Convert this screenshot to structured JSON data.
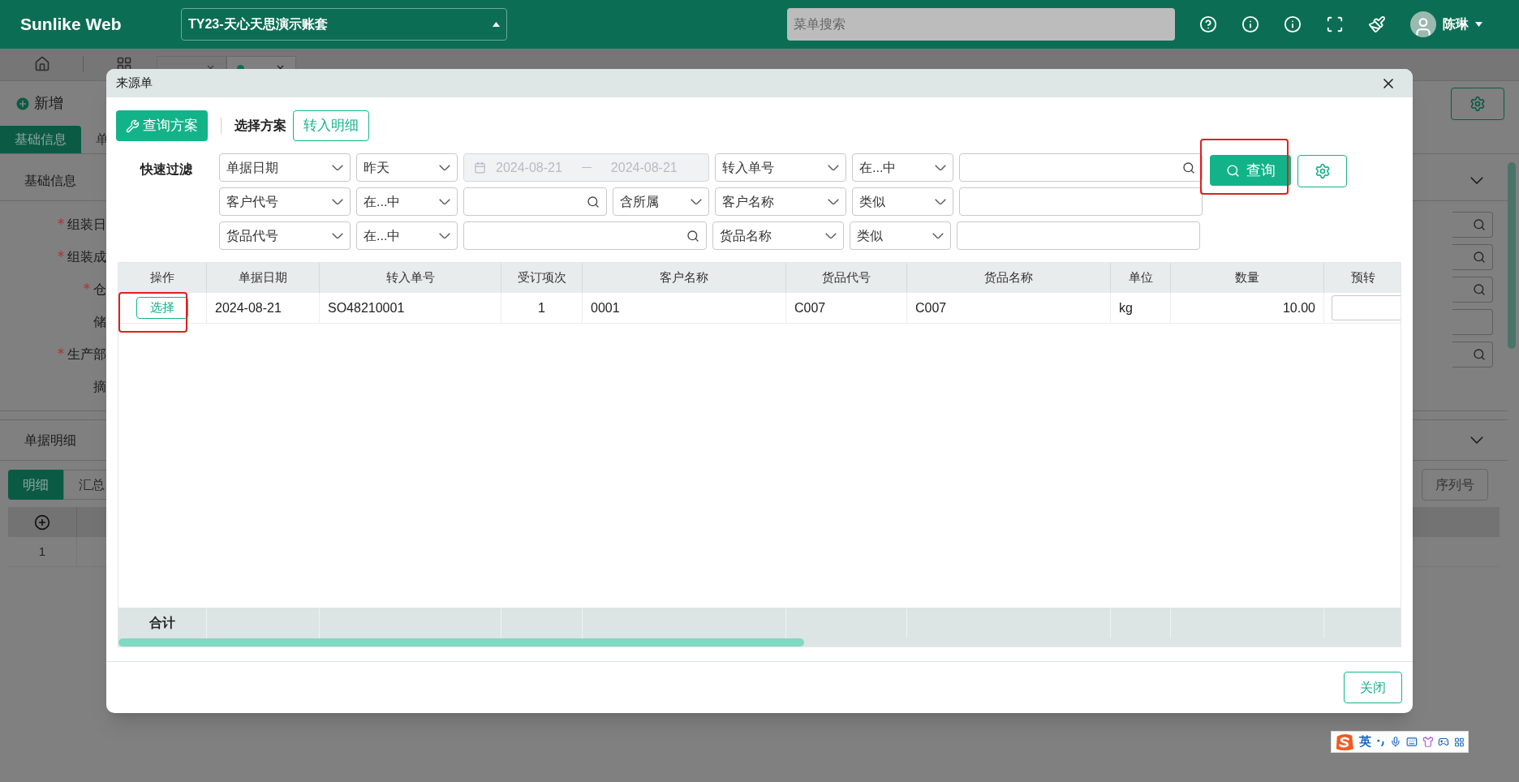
{
  "header": {
    "logo": "Sunlike Web",
    "account": "TY23-天心天思演示账套",
    "search_placeholder": "菜单搜索",
    "user": "陈琳"
  },
  "page_tabs": [
    {
      "selected": false
    },
    {
      "selected": true
    }
  ],
  "toolbar": {
    "new_button": "新增"
  },
  "form_tabs": [
    {
      "label": "基础信息",
      "selected": true
    },
    {
      "label": "单",
      "selected": false
    }
  ],
  "basic_section": {
    "title": "基础信息",
    "fields": [
      {
        "label": "组装日",
        "required": true,
        "kind": "search"
      },
      {
        "label": "组装成",
        "required": true,
        "kind": "search"
      },
      {
        "label": "仓",
        "required": true,
        "kind": "search"
      },
      {
        "label": "储",
        "required": false,
        "kind": "plain"
      },
      {
        "label": "生产部",
        "required": true,
        "kind": "search"
      },
      {
        "label": "摘",
        "required": false,
        "kind": "none"
      }
    ]
  },
  "detail_section": {
    "title": "单据明细",
    "tabs": [
      {
        "label": "明细",
        "selected": true
      },
      {
        "label": "汇总",
        "selected": false
      }
    ],
    "serial_button": "序列号",
    "rows": [
      "1"
    ]
  },
  "dialog": {
    "title": "来源单",
    "scheme_button": "查询方案",
    "scheme_label": "选择方案",
    "transfer_button": "转入明细",
    "filter_label": "快速过滤",
    "filter_rows": [
      [
        {
          "kind": "field",
          "value": "单据日期"
        },
        {
          "kind": "operator",
          "value": "昨天"
        },
        {
          "kind": "date",
          "from": "2024-08-21",
          "to": "2024-08-21",
          "disabled": true
        },
        {
          "kind": "field",
          "value": "转入单号"
        },
        {
          "kind": "operator",
          "value": "在...中"
        },
        {
          "kind": "search"
        }
      ],
      [
        {
          "kind": "field",
          "value": "客户代号"
        },
        {
          "kind": "operator",
          "value": "在...中"
        },
        {
          "kind": "search_scope",
          "scope": "含所属"
        },
        {
          "kind": "field",
          "value": "客户名称"
        },
        {
          "kind": "operator",
          "value": "类似"
        },
        {
          "kind": "text"
        }
      ],
      [
        {
          "kind": "field",
          "value": "货品代号"
        },
        {
          "kind": "operator",
          "value": "在...中"
        },
        {
          "kind": "search"
        },
        {
          "kind": "field",
          "value": "货品名称"
        },
        {
          "kind": "operator",
          "value": "类似"
        },
        {
          "kind": "text"
        }
      ]
    ],
    "query_button": "查询",
    "table": {
      "columns": [
        {
          "label": "操作",
          "kind": "action"
        },
        {
          "label": "单据日期",
          "kind": "text"
        },
        {
          "label": "转入单号",
          "kind": "text"
        },
        {
          "label": "受订项次",
          "kind": "index"
        },
        {
          "label": "客户名称",
          "kind": "text"
        },
        {
          "label": "货品代号",
          "kind": "text"
        },
        {
          "label": "货品名称",
          "kind": "text"
        },
        {
          "label": "单位",
          "kind": "text"
        },
        {
          "label": "数量",
          "kind": "number"
        },
        {
          "label": "预转",
          "kind": "input"
        }
      ],
      "rows": [
        {
          "cells": [
            "选择",
            "2024-08-21",
            "SO48210001",
            "1",
            "0001",
            "C007",
            "C007",
            "kg",
            "10.00"
          ]
        }
      ],
      "total_label": "合计"
    },
    "close_button": "关闭"
  },
  "ime": {
    "mode": "英"
  }
}
